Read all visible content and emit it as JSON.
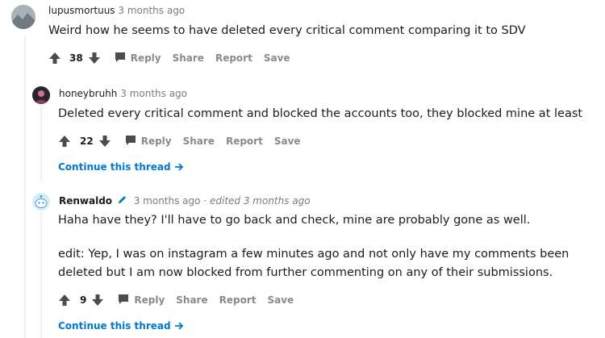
{
  "comments": [
    {
      "user": "lupusmortuus",
      "time": "3 months ago",
      "body": "Weird how he seems to have deleted every critical comment comparing it to SDV",
      "votes": "38",
      "actions": [
        "Reply",
        "Share",
        "Report",
        "Save"
      ]
    },
    {
      "user": "honeybruhh",
      "time": "3 months ago",
      "body": "Deleted every critical comment and blocked the accounts too, they blocked mine at least",
      "votes": "22",
      "actions": [
        "Reply",
        "Share",
        "Report",
        "Save"
      ],
      "continue": "Continue this thread"
    },
    {
      "user": "Renwaldo",
      "time": "3 months ago",
      "separator": "·",
      "edited": "edited 3 months ago",
      "body_lines": [
        "Haha have they? I'll have to go back and check, mine are probably gone as well.",
        "edit: Yep, I was on instagram a few minutes ago and not only have my comments been",
        "deleted but I am now blocked from further commenting on any of their submissions."
      ],
      "votes": "9",
      "actions": [
        "Reply",
        "Share",
        "Report",
        "Save"
      ],
      "continue": "Continue this thread"
    }
  ],
  "colors": {
    "accent": "#0079d3",
    "muted": "#878a8c",
    "text": "#1c1c1c",
    "thread_line": "#edeff1",
    "flair_icon": "#0079d3"
  },
  "icons": [
    "upvote-icon",
    "downvote-icon",
    "reply-icon",
    "pencil-flair-icon",
    "arrow-right-icon"
  ]
}
